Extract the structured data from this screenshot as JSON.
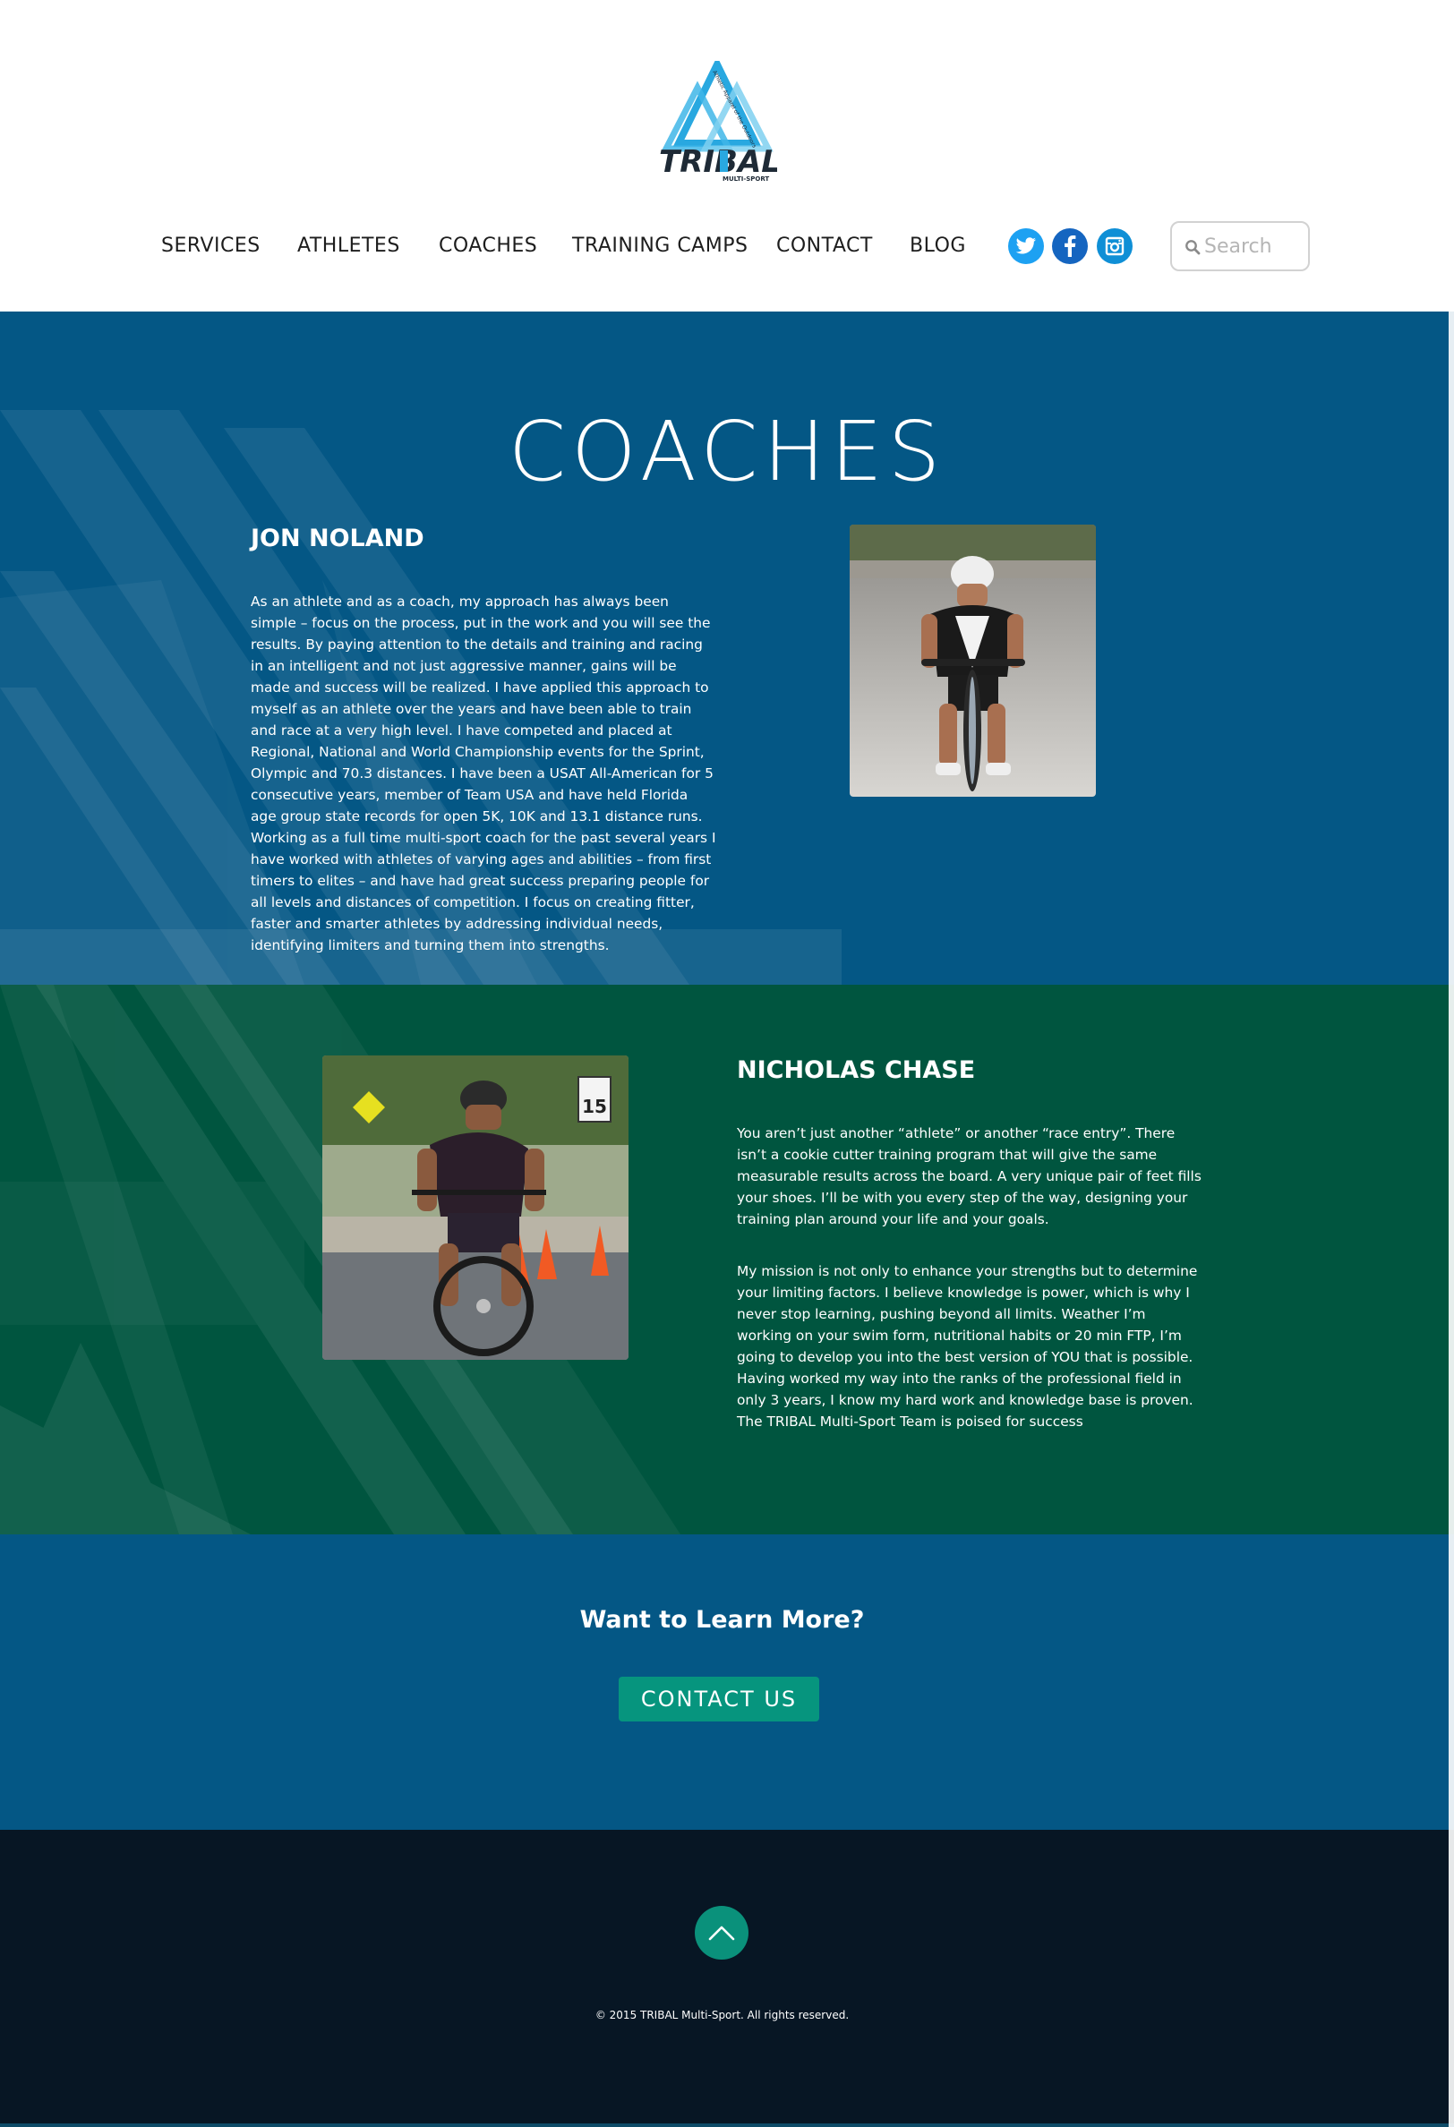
{
  "header": {
    "logo": {
      "brand": "TRIBAL",
      "tagline": "MULTI-SPORT",
      "icon": "triangle-logo-icon"
    },
    "nav": [
      {
        "label": "SERVICES"
      },
      {
        "label": "ATHLETES"
      },
      {
        "label": "COACHES"
      },
      {
        "label": "TRAINING CAMPS"
      },
      {
        "label": "CONTACT"
      },
      {
        "label": "BLOG"
      }
    ],
    "social": [
      {
        "icon": "twitter-icon",
        "color": "#1da1f2"
      },
      {
        "icon": "facebook-icon",
        "color": "#1565c0"
      },
      {
        "icon": "instagram-icon",
        "color": "#0f8fd6"
      }
    ],
    "search": {
      "placeholder": "Search",
      "value": ""
    }
  },
  "main": {
    "title": "COACHES",
    "coaches": [
      {
        "name": "JON NOLAND",
        "bio": [
          "As an athlete and as a coach, my approach has always been simple – focus on the process, put in the work and you will see the results. By paying attention to the details and training and racing in an intelligent and not just aggressive manner, gains will be made and success will be realized. I have applied this approach to myself as an athlete over the years and have been able to train and race at a very high level. I have competed and placed at Regional, National and World Championship events for the Sprint, Olympic and 70.3 distances. I have been a USAT All-American for 5 consecutive years, member of Team USA and have held Florida age group state records for open 5K, 10K and 13.1 distance runs. Working as a full time multi-sport coach for the past several years I have worked with athletes of varying ages and abilities – from first timers to elites – and have had great success preparing people for all levels and distances of competition. I focus on creating fitter, faster and smarter athletes by addressing individual needs, identifying limiters and turning them into strengths."
        ],
        "photo": "cyclist-photo"
      },
      {
        "name": "NICHOLAS CHASE",
        "bio": [
          "You aren’t just another “athlete” or another “race entry”. There isn’t a cookie cutter training program that will give the same measurable results across the board. A very unique pair of feet fills your shoes. I’ll be with you every step of the way, designing your training plan around your life and your goals.",
          "My mission is not only to enhance your strengths but to determine your limiting factors. I believe knowledge is power, which is why I never stop learning, pushing beyond all limits. Weather I’m working on your swim form, nutritional habits or 20 min FTP, I’m going to develop you into the best version of YOU that is possible. Having worked my way into the ranks of the professional field in only 3 years, I know my hard work and knowledge base is proven. The TRIBAL Multi-Sport Team is poised for success"
        ],
        "photo": "cyclist-race-photo"
      }
    ]
  },
  "cta": {
    "heading": "Want to Learn More?",
    "button_label": "CONTACT US"
  },
  "footer": {
    "copyright": "© 2015 TRIBAL Multi-Sport. All rights reserved.",
    "back_to_top_icon": "chevron-up-icon"
  },
  "colors": {
    "blue_section": "#045785",
    "green_section": "#00553f",
    "accent": "#06957e",
    "footer": "#071624"
  }
}
